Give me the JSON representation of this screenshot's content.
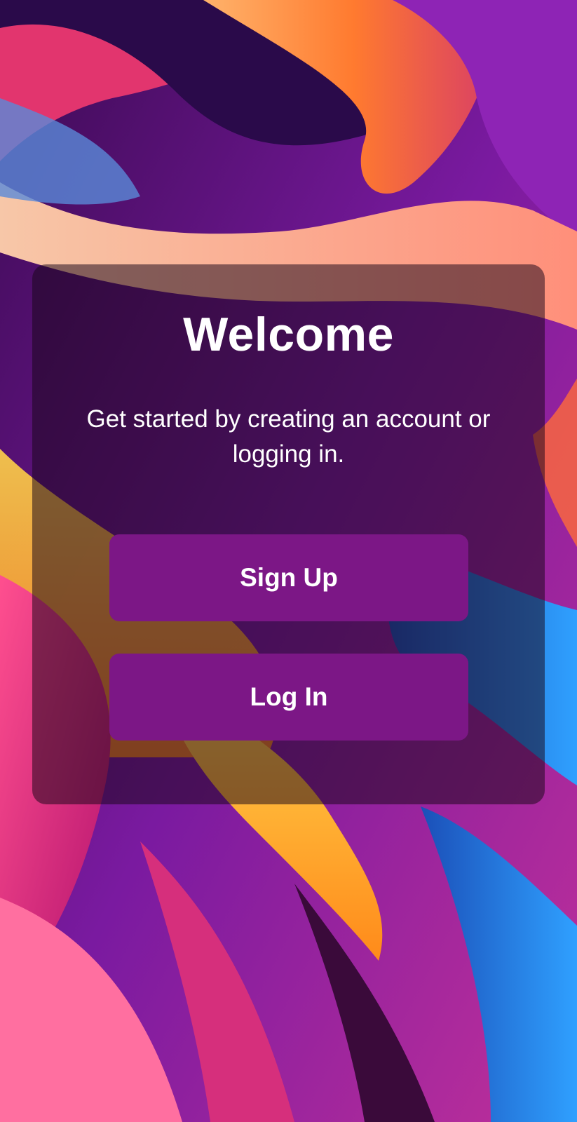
{
  "welcome": {
    "title": "Welcome",
    "subtitle": "Get started by creating an account or logging in.",
    "signup_label": "Sign Up",
    "login_label": "Log In"
  },
  "colors": {
    "button": "#7c1786",
    "card_overlay": "rgba(25,5,25,0.52)",
    "text": "#ffffff"
  }
}
